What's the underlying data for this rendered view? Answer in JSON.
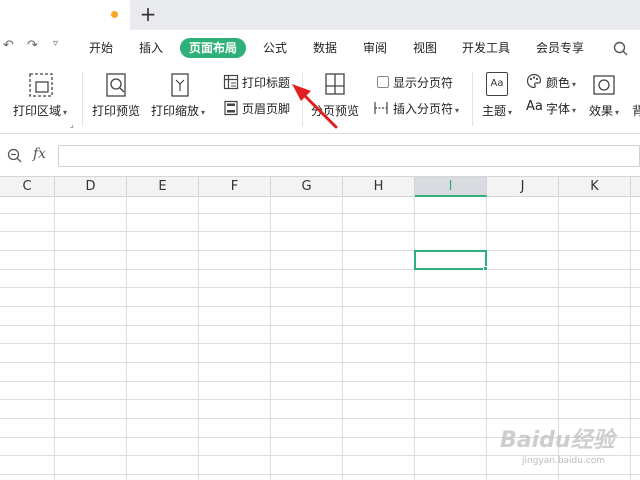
{
  "tabbar": {
    "new_tab": "+"
  },
  "menubar": {
    "items": [
      "开始",
      "插入",
      "页面布局",
      "公式",
      "数据",
      "审阅",
      "视图",
      "开发工具",
      "会员专享"
    ],
    "active_item": "页面布局"
  },
  "ribbon": {
    "print_area": "打印区域",
    "print_preview": "打印预览",
    "print_scale": "打印缩放",
    "print_titles": "打印标题",
    "header_footer": "页眉页脚",
    "page_break_preview": "分页预览",
    "show_page_breaks": "显示分页符",
    "insert_page_break": "插入分页符",
    "theme": "主题",
    "colors": "颜色",
    "fonts": "字体",
    "effects": "效果",
    "font_icon_text": "Aa",
    "theme_icon_text": "Aa",
    "truncated_label": "背"
  },
  "formulabar": {
    "fx": "fx",
    "value": ""
  },
  "sheet": {
    "columns": [
      "C",
      "D",
      "E",
      "F",
      "G",
      "H",
      "I",
      "J",
      "K"
    ],
    "selected_column": "I",
    "selected_cell": "I3"
  },
  "annotation": {
    "arrow_color": "#e02020"
  },
  "colors": {
    "accent": "#2fb07a",
    "tab_dot": "#f5a623"
  },
  "watermark": {
    "main": "Baidu经验",
    "sub": "jingyan.baidu.com"
  }
}
